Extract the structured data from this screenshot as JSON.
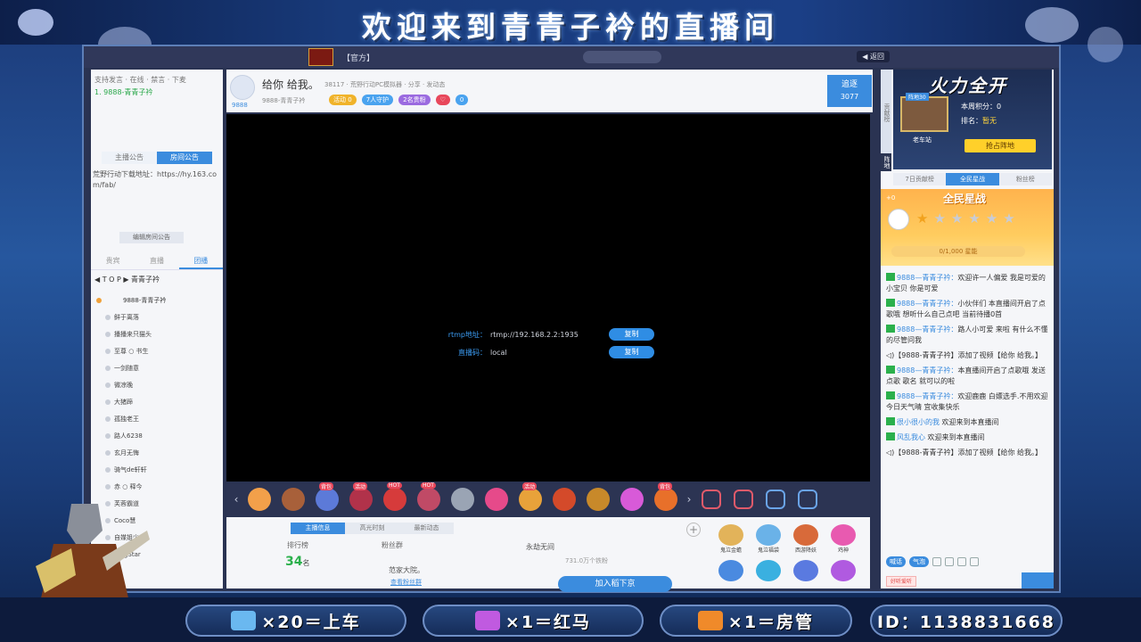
{
  "banner": {
    "title": "欢迎来到青青子衿的直播间"
  },
  "topbar": {
    "text": "【官方】",
    "button": "",
    "right_label": "◀ 返回"
  },
  "left": {
    "header": "支持发言 · 在线 · 禁言 · 下麦",
    "user_line": "1. 9888-青青子衿",
    "tabs": [
      "主播公告",
      "房间公告"
    ],
    "notice": "荒野行动下载地址：https://hy.163.com/fab/",
    "edit_notice": "编辑房间公告",
    "rank_tabs": [
      "贵宾",
      "直播",
      "团播"
    ],
    "top_label": "◀ T O P ▶ 青青子衿",
    "first_user": "9888-青青子衿",
    "users": [
      "鲜于离落",
      "播播来只猫头",
      "至尊 ○ 书生",
      "一剑随意",
      "微凉晚",
      "大猪蹄",
      "孤独老王",
      "路人6238",
      "玄月无悔",
      "骑气de轩轩",
      "赤 ○ 释今",
      "芙蓉霸道",
      "Coco慧",
      "自媒姐少",
      "KingStar"
    ]
  },
  "room": {
    "number": "9888",
    "title": "给你 给我。",
    "meta": "38117 · 荒野行动PC模拟器 · 分享 · 发动态",
    "owner": "9888-青青子衿",
    "badges": [
      {
        "text": "活动 0",
        "color": "#f0b32a"
      },
      {
        "text": "7人守护",
        "color": "#4aa3ef"
      },
      {
        "text": "2名贵粉",
        "color": "#9b6be0"
      },
      {
        "text": "♡",
        "color": "#e8475b"
      },
      {
        "text": "0",
        "color": "#4aa3ef"
      }
    ],
    "follow_label": "追逐",
    "follow_count": "3077"
  },
  "video": {
    "rtmp_label": "rtmp地址：",
    "rtmp_value": "rtmp://192.168.2.2:1935",
    "stream_label": "直播码：",
    "stream_value": "local",
    "copy_label": "复制"
  },
  "gifts": {
    "items": [
      {
        "color": "#f2a04a",
        "tag": ""
      },
      {
        "color": "#a8603a",
        "tag": ""
      },
      {
        "color": "#5c7ad8",
        "tag": "背包"
      },
      {
        "color": "#b1324a",
        "tag": "活动"
      },
      {
        "color": "#d63b3b",
        "tag": "HOT"
      },
      {
        "color": "#c04a66",
        "tag": "HOT"
      },
      {
        "color": "#9aa4b4",
        "tag": ""
      },
      {
        "color": "#e64a8a",
        "tag": ""
      },
      {
        "color": "#e8a23a",
        "tag": "活动"
      },
      {
        "color": "#d44a2a",
        "tag": ""
      },
      {
        "color": "#c8892a",
        "tag": ""
      },
      {
        "color": "#d85ad8",
        "tag": ""
      },
      {
        "color": "#e8702a",
        "tag": "背包"
      }
    ]
  },
  "below": {
    "tabs": [
      "主播信息",
      "高光时刻",
      "最新动态"
    ],
    "rank_label": "排行榜",
    "rank_value": "34",
    "rank_unit": "名",
    "fans_label": "粉丝群",
    "fans_name": "范家大院。",
    "fans_link": "查看粉丝群",
    "guest_name": "永劫无间",
    "guest_fans": "731.0万个铁粉",
    "join_label": "加入稻下京",
    "grid": [
      {
        "label": "鬼泣金蟾",
        "color": "#e2b35a"
      },
      {
        "label": "鬼泣福袋",
        "color": "#6ab2e8"
      },
      {
        "label": "西游降妖",
        "color": "#d86a3a"
      },
      {
        "label": "鸡神",
        "color": "#e85ab0"
      },
      {
        "label": "",
        "color": "#4a8ae0"
      },
      {
        "label": "",
        "color": "#3ab0e0"
      },
      {
        "label": "",
        "color": "#5a7ae0"
      },
      {
        "label": "",
        "color": "#b05ae0"
      }
    ]
  },
  "right": {
    "vtab_label": "贡献榜",
    "vtab2_label": "阵地",
    "fire_title": "火力全开",
    "fire_tag": "阵地30",
    "fire_location": "老车站",
    "fire_score": "本周积分：0",
    "fire_rank_label": "排名：",
    "fire_rank_value": "暂无",
    "grab_label": "抢占阵地",
    "tabs": [
      "7日贡献榜",
      "全民星战",
      "粉丝榜"
    ],
    "star_title": "全民星战",
    "star_plus": "+0",
    "star_bar": "0/1,000 星能",
    "stars_lit": 1,
    "stars_total": 6,
    "messages": [
      {
        "user": "9888—青青子衿：",
        "text": "欢迎许一人偏爱 我是可爱的小宝贝 你是可爱"
      },
      {
        "user": "9888—青青子衿：",
        "text": "小伙伴们 本直播间开启了点歌哦 想听什么自己点吧 当前待播0首"
      },
      {
        "user": "9888—青青子衿：",
        "text": "路人小可爱 来啦 有什么不懂的尽管问我"
      },
      {
        "user": "",
        "text": "◁)【9888-青青子衿】添加了视频【给你 给我。】"
      },
      {
        "user": "9888—青青子衿：",
        "text": "本直播间开启了点歌哦 发送 点歌 歌名 就可以的啦"
      },
      {
        "user": "9888—青青子衿：",
        "text": "欢迎鹿鹿 白嫖选手.不用欢迎 今日天气晴 宜收集快乐"
      },
      {
        "user": "很小很小的我",
        "text": " 欢迎来到本直播间"
      },
      {
        "user": "风乱我心",
        "text": " 欢迎来到本直播间"
      },
      {
        "user": "",
        "text": "◁)【9888-青青子衿】添加了视频【给你 给我。】"
      }
    ],
    "bottom_pills": [
      "喊话",
      "气泡"
    ],
    "input_tag": "好听爱听"
  },
  "bottom": {
    "items": [
      {
        "text": "×20＝上车",
        "color": "#6ab8f0"
      },
      {
        "text": "×1＝红马",
        "color": "#c05ae0"
      },
      {
        "text": "×1＝房管",
        "color": "#f08a2a"
      },
      {
        "text": "ID：1138831668",
        "color": ""
      }
    ]
  }
}
